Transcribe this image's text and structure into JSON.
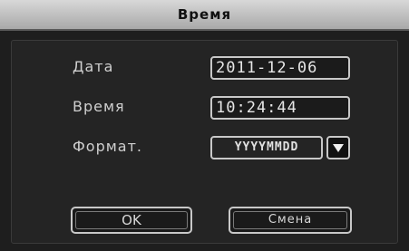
{
  "dialog": {
    "title": "Время",
    "date_label": "Дата",
    "date_value": "2011-12-06",
    "time_label": "Время",
    "time_value": "10:24:44",
    "format_label": "Формат.",
    "format_value": "YYYYMMDD",
    "ok_label": "OK",
    "cancel_label": "Смена"
  }
}
